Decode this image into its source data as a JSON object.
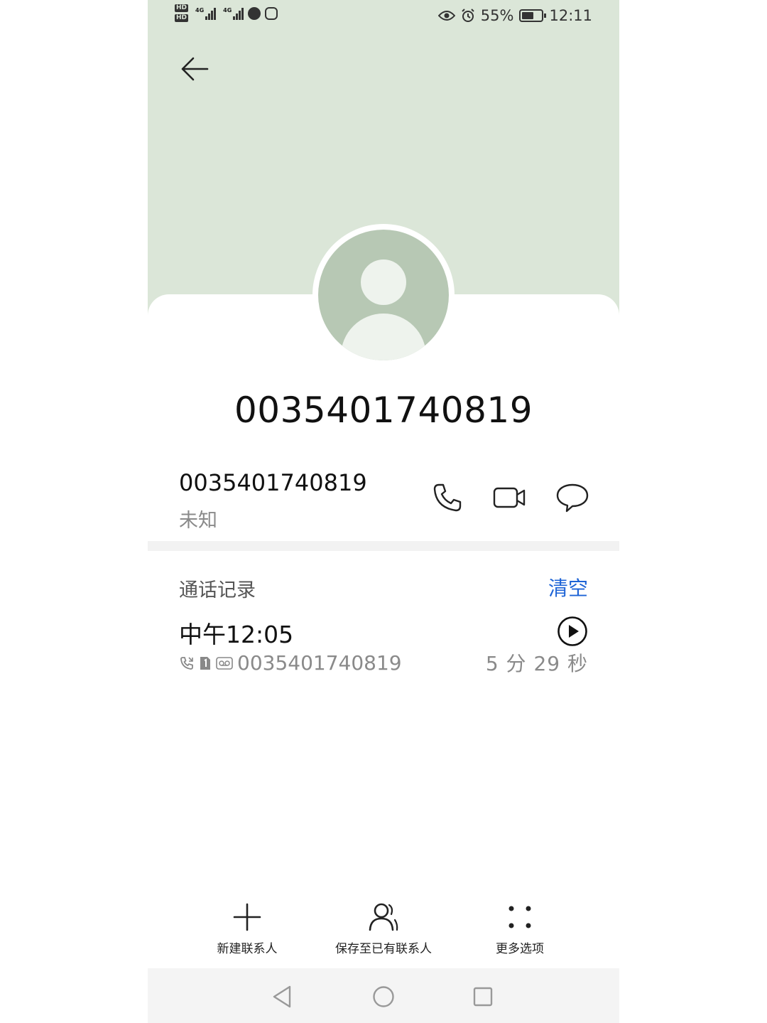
{
  "status_bar": {
    "hd_labels": [
      "HD",
      "HD"
    ],
    "network_labels": [
      "4G",
      "4G"
    ],
    "battery_percent": "55%",
    "time": "12:11"
  },
  "contact": {
    "display_number": "0035401740819"
  },
  "number_row": {
    "number": "0035401740819",
    "location": "未知"
  },
  "call_log": {
    "title": "通话记录",
    "clear_label": "清空",
    "entries": [
      {
        "time": "中午12:05",
        "number": "0035401740819",
        "duration": "5 分 29 秒"
      }
    ]
  },
  "bottom_actions": {
    "new_contact": "新建联系人",
    "save_existing": "保存至已有联系人",
    "more_options": "更多选项"
  },
  "colors": {
    "header_bg": "#dbe6d8",
    "avatar_bg": "#b7c8b4",
    "accent_blue": "#1d63d6"
  }
}
